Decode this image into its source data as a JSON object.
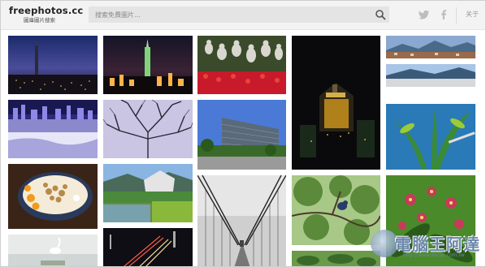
{
  "header": {
    "logo_title": "freephotos.cc",
    "logo_subtitle": "圖庫圖片搜索",
    "search_placeholder": "搜索免費圖片...",
    "about_label": "关于"
  },
  "icons": {
    "search": "search-icon",
    "twitter": "twitter-icon",
    "facebook": "facebook-icon"
  },
  "photos": [
    "taipei-101-night-skyline",
    "taipei-101-night-city",
    "white-buddha-statues-red-flowers",
    "dark-building-night",
    "mountain-town-view",
    "city-skyline-purple-reflection",
    "bare-tree-branches-sky",
    "modern-office-building-blue-sky",
    "harbor-mountain-coast",
    "bowl-granola-fruit",
    "modern-building-lake-green",
    "suspension-bridge-black-white",
    "bird-on-tree-branch",
    "green-leaves-branch",
    "pink-orchid-flowers",
    "white-egret-water",
    "highway-light-trails-night",
    "garden-mountains"
  ],
  "watermark": {
    "text": "電腦王阿達",
    "url": "http://www.kocpc.com.tw"
  },
  "colors": {
    "header_bg": "#f3f3f3",
    "search_bg": "#e4e4e4",
    "watermark": "#6b87aa"
  }
}
